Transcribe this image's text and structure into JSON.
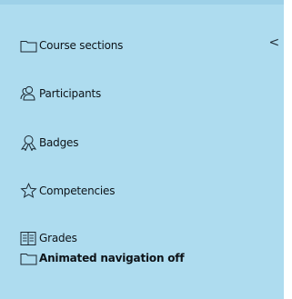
{
  "nav": {
    "items": [
      {
        "label": "Course sections",
        "icon": "folder-icon",
        "expander": "<"
      },
      {
        "label": "Participants",
        "icon": "users-icon"
      },
      {
        "label": "Badges",
        "icon": "badge-icon"
      },
      {
        "label": "Competencies",
        "icon": "star-icon"
      },
      {
        "label": "Grades",
        "icon": "gradebook-icon"
      },
      {
        "label": "Animated navigation off",
        "icon": "folder-icon"
      }
    ]
  },
  "colors": {
    "panel_background": "#aedcef",
    "panel_top_border": "#9ed1e8",
    "text": "#0d1318"
  }
}
